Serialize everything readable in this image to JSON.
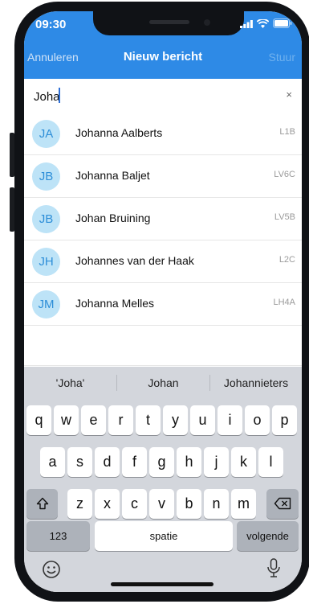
{
  "status": {
    "time": "09:30"
  },
  "nav": {
    "cancel": "Annuleren",
    "title": "Nieuw bericht",
    "send": "Stuur"
  },
  "search": {
    "value": "Joha",
    "clear": "×"
  },
  "contacts": [
    {
      "initials": "JA",
      "name": "Johanna  Aalberts",
      "code": "L1B"
    },
    {
      "initials": "JB",
      "name": "Johanna  Baljet",
      "code": "LV6C"
    },
    {
      "initials": "JB",
      "name": "Johan Bruining",
      "code": "LV5B"
    },
    {
      "initials": "JH",
      "name": "Johannes van der Haak",
      "code": "L2C"
    },
    {
      "initials": "JM",
      "name": "Johanna  Melles",
      "code": "LH4A"
    }
  ],
  "keyboard": {
    "suggestions": [
      "'Joha'",
      "Johan",
      "Johannieters"
    ],
    "row1": [
      "q",
      "w",
      "e",
      "r",
      "t",
      "y",
      "u",
      "i",
      "o",
      "p"
    ],
    "row2": [
      "a",
      "s",
      "d",
      "f",
      "g",
      "h",
      "j",
      "k",
      "l"
    ],
    "row3": [
      "z",
      "x",
      "c",
      "v",
      "b",
      "n",
      "m"
    ],
    "numbers": "123",
    "space": "spatie",
    "next": "volgende"
  },
  "icons": [
    "signal-icon",
    "wifi-icon",
    "battery-icon",
    "shift-icon",
    "backspace-icon",
    "emoji-icon",
    "microphone-icon"
  ],
  "colors": {
    "header": "#2e8ae6",
    "avatar_bg": "#bde3f7",
    "avatar_text": "#2d8ed8"
  }
}
